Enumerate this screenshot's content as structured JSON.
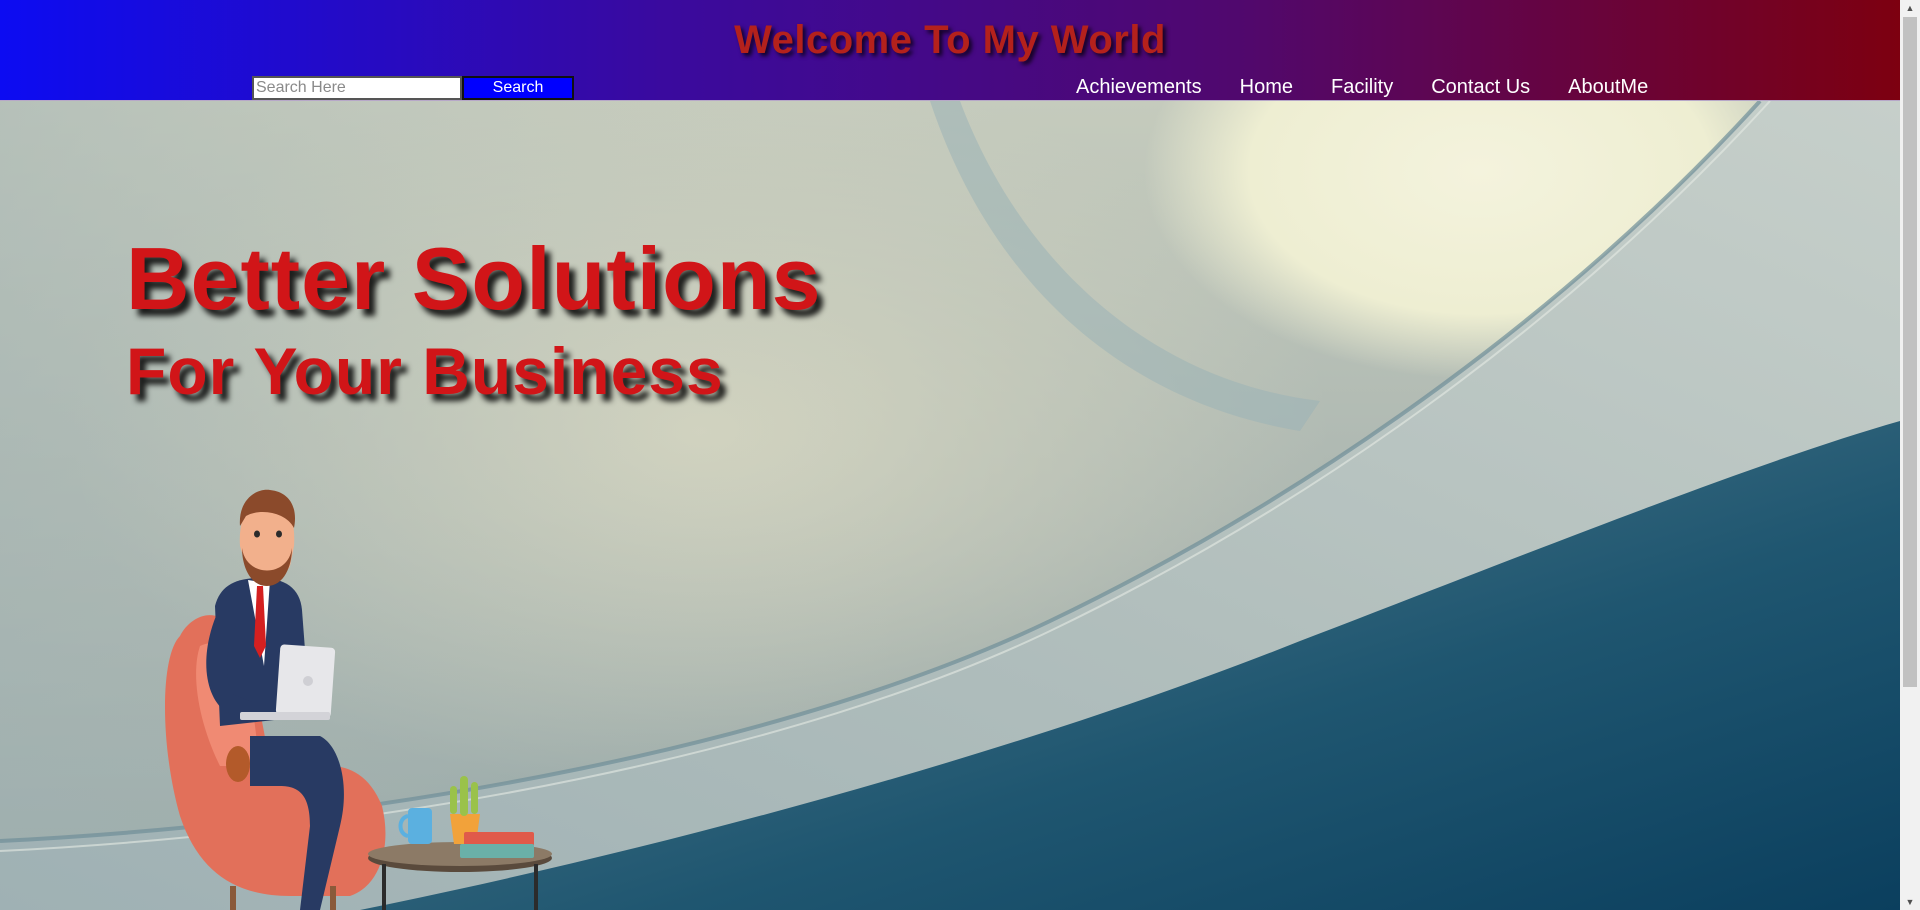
{
  "header": {
    "title": "Welcome To My World",
    "search": {
      "placeholder": "Search Here",
      "value": "",
      "button_label": "Search"
    },
    "nav": [
      {
        "label": "Achievements"
      },
      {
        "label": "Home"
      },
      {
        "label": "Facility"
      },
      {
        "label": "Contact Us"
      },
      {
        "label": "AboutMe"
      }
    ]
  },
  "hero": {
    "headline_line1": "Better Solutions",
    "headline_line2": "For Your Business",
    "illustration": "businessman-in-armchair-with-laptop"
  },
  "colors": {
    "header_gradient_start": "#0c0cf2",
    "header_gradient_end": "#7d0010",
    "title_red": "#b4211c",
    "headline_red": "#d11518",
    "search_button": "#0000ff"
  },
  "scrollbar": {
    "up_icon": "scroll-up-arrow-icon",
    "down_icon": "scroll-down-arrow-icon"
  }
}
